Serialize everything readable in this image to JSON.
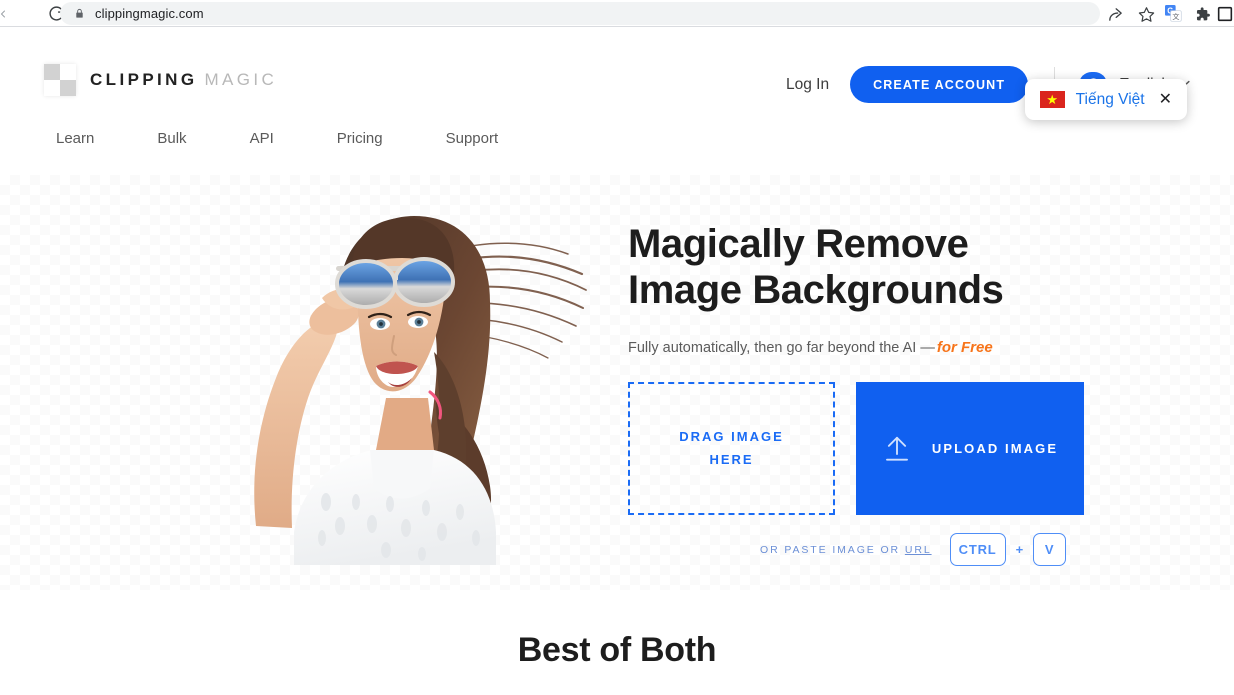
{
  "browser": {
    "url": "clippingmagic.com",
    "back_icon": "back-arrow-icon",
    "reload_icon": "reload-icon",
    "lock_icon": "lock-icon",
    "share_icon": "share-icon",
    "star_icon": "bookmark-star-icon",
    "translate_icon": "google-translate-icon",
    "extensions_icon": "extensions-puzzle-icon",
    "sidebar_icon": "sidebar-panel-icon"
  },
  "header": {
    "logo": {
      "primary": "CLIPPING",
      "secondary": "MAGIC",
      "mark": "checkerboard-logo-icon"
    },
    "nav": [
      {
        "label": "Learn"
      },
      {
        "label": "Bulk"
      },
      {
        "label": "API"
      },
      {
        "label": "Pricing"
      },
      {
        "label": "Support"
      }
    ],
    "login_label": "Log In",
    "create_account_label": "CREATE ACCOUNT",
    "language": {
      "icon": "globe-icon",
      "label": "English",
      "chevron": "⌄"
    },
    "language_popup": {
      "flag": "vietnam-flag-icon",
      "star": "★",
      "label": "Tiếng Việt",
      "close": "✕"
    }
  },
  "hero": {
    "title": "Magically Remove\nImage Backgrounds",
    "subtitle": "Fully automatically, then go far beyond the AI —",
    "subtitle_accent": "for Free",
    "photo_alt": "woman-with-sunglasses-photo",
    "drop_zone_label": "DRAG IMAGE\nHERE",
    "upload_label": "UPLOAD IMAGE",
    "upload_icon": "upload-arrow-icon",
    "paste_text": "OR PASTE IMAGE OR ",
    "paste_url_label": "URL",
    "key_ctrl": "CTRL",
    "key_plus": "+",
    "key_v": "V"
  },
  "section_best": {
    "heading": "Best of Both"
  },
  "colors": {
    "brand_blue": "#1060f0",
    "bubble_blue": "#1a6bf5",
    "link_blue": "#1a73e8",
    "accent_orange": "#f7741a",
    "flag_red": "#da251d",
    "flag_yellow": "#ffff00",
    "text_dark": "#1d1d1d",
    "text_muted": "#5a5a5a",
    "chrome_bar": "#f1f3f4"
  }
}
